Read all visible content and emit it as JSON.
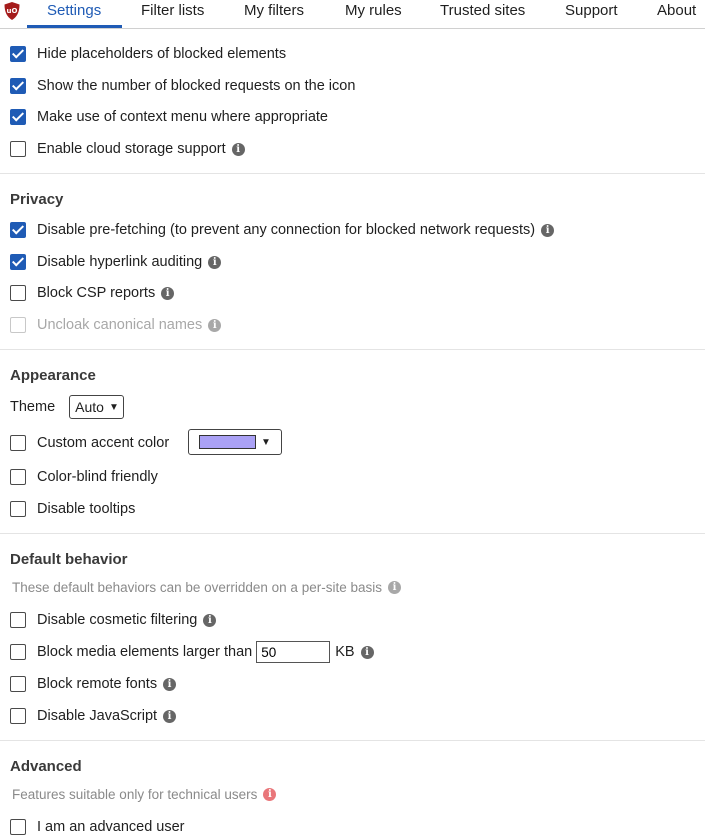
{
  "colors": {
    "accent": "#1f5bb5",
    "swatch": "#aaa1f5",
    "logo": "#a51c1c"
  },
  "tabs": [
    {
      "label": "Settings",
      "active": true
    },
    {
      "label": "Filter lists"
    },
    {
      "label": "My filters"
    },
    {
      "label": "My rules"
    },
    {
      "label": "Trusted sites"
    },
    {
      "label": "Support"
    },
    {
      "label": "About"
    }
  ],
  "general": [
    {
      "label": "Hide placeholders of blocked elements",
      "checked": true
    },
    {
      "label": "Show the number of blocked requests on the icon",
      "checked": true
    },
    {
      "label": "Make use of context menu where appropriate",
      "checked": true
    },
    {
      "label": "Enable cloud storage support",
      "checked": false,
      "icon": "info-icon"
    }
  ],
  "privacy": {
    "heading": "Privacy",
    "items": [
      {
        "label": "Disable pre-fetching (to prevent any connection for blocked network requests)",
        "checked": true
      },
      {
        "label": "Disable hyperlink auditing",
        "checked": true
      },
      {
        "label": "Block CSP reports",
        "checked": false
      },
      {
        "label": "Uncloak canonical names",
        "checked": false,
        "disabled": true
      }
    ]
  },
  "appearance": {
    "heading": "Appearance",
    "theme_label": "Theme",
    "theme_value": "Auto",
    "items": [
      {
        "label": "Custom accent color",
        "checked": false
      },
      {
        "label": "Color-blind friendly",
        "checked": false
      },
      {
        "label": "Disable tooltips",
        "checked": false
      }
    ]
  },
  "default_behavior": {
    "heading": "Default behavior",
    "note": "These default behaviors can be overridden on a per-site basis",
    "items": [
      {
        "label": "Disable cosmetic filtering",
        "checked": false
      },
      {
        "label": "Block media elements larger than",
        "checked": false,
        "value": "50",
        "unit": "KB"
      },
      {
        "label": "Block remote fonts",
        "checked": false
      },
      {
        "label": "Disable JavaScript",
        "checked": false
      }
    ]
  },
  "advanced": {
    "heading": "Advanced",
    "note": "Features suitable only for technical users",
    "items": [
      {
        "label": "I am an advanced user",
        "checked": false
      }
    ]
  }
}
